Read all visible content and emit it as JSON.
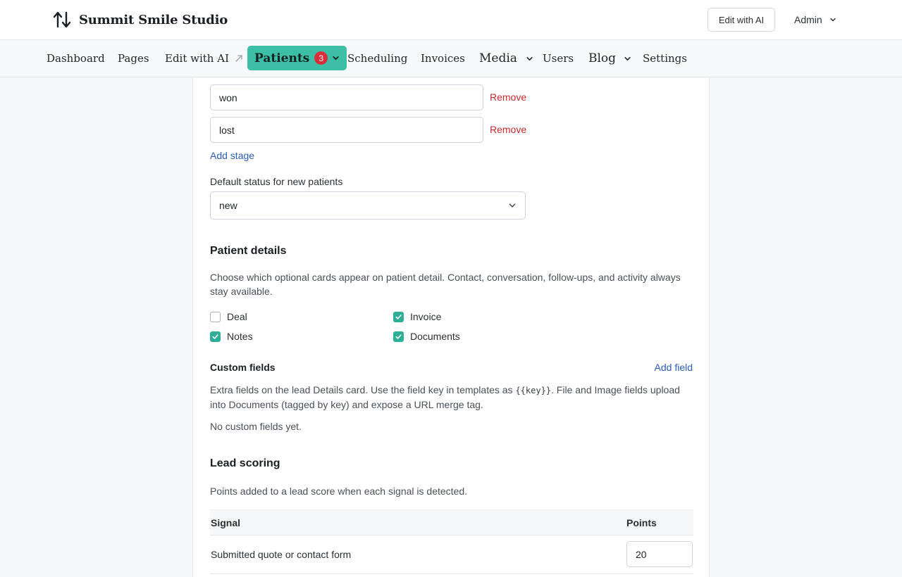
{
  "header": {
    "brand_name": "Summit Smile Studio",
    "brand_icon": "sort-arrows-icon",
    "edit_ai_label": "Edit with AI",
    "admin_label": "Admin"
  },
  "nav": {
    "items": [
      {
        "label": "Dashboard"
      },
      {
        "label": "Pages"
      },
      {
        "label": "Edit with AI"
      },
      {
        "label": "Patients",
        "badge": "3"
      },
      {
        "label": "Scheduling"
      },
      {
        "label": "Invoices"
      },
      {
        "label": "Media"
      },
      {
        "label": "Users"
      },
      {
        "label": "Blog"
      },
      {
        "label": "Settings"
      }
    ]
  },
  "stages": {
    "items": [
      {
        "value": "won",
        "remove_label": "Remove"
      },
      {
        "value": "lost",
        "remove_label": "Remove"
      }
    ],
    "add_label": "Add stage",
    "default_status_label": "Default status for new patients",
    "default_status_value": "new"
  },
  "patient_details": {
    "title": "Patient details",
    "description": "Choose which optional cards appear on patient detail. Contact, conversation, follow-ups, and activity always stay available.",
    "cards": [
      {
        "label": "Deal",
        "checked": false
      },
      {
        "label": "Invoice",
        "checked": true
      },
      {
        "label": "Notes",
        "checked": true
      },
      {
        "label": "Documents",
        "checked": true
      }
    ]
  },
  "custom_fields": {
    "title": "Custom fields",
    "add_label": "Add field",
    "desc_part1": "Extra fields on the lead Details card. Use the field key in templates as ",
    "desc_code": "{{key}}",
    "desc_part2": ". File and Image fields upload into Documents (tagged by key) and expose a URL merge tag.",
    "empty_text": "No custom fields yet."
  },
  "lead_scoring": {
    "title": "Lead scoring",
    "description": "Points added to a lead score when each signal is detected.",
    "col_signal": "Signal",
    "col_points": "Points",
    "rows": [
      {
        "signal": "Submitted quote or contact form",
        "points": "20"
      }
    ]
  },
  "colors": {
    "accent": "#3dbfa7",
    "badge": "#d92d3a",
    "link": "#2b5cb8",
    "danger": "#c52b2b"
  }
}
